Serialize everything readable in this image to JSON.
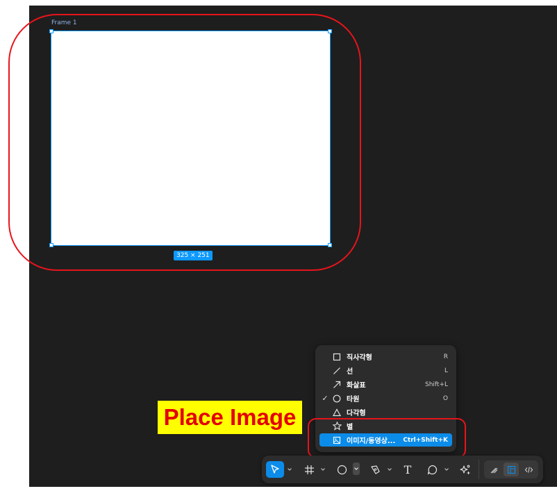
{
  "canvas": {
    "frame_label": "Frame 1",
    "size_badge": "325 × 251"
  },
  "annotation": {
    "label": "Place Image",
    "color": "#e8141b",
    "label_bg": "#ffff00"
  },
  "shape_menu": {
    "items": [
      {
        "label": "직사각형",
        "shortcut": "R",
        "icon": "rectangle-icon",
        "checked": false
      },
      {
        "label": "선",
        "shortcut": "L",
        "icon": "line-icon",
        "checked": false
      },
      {
        "label": "화살표",
        "shortcut": "Shift+L",
        "icon": "arrow-icon",
        "checked": false
      },
      {
        "label": "타원",
        "shortcut": "O",
        "icon": "ellipse-icon",
        "checked": true,
        "check_mark": "✓"
      },
      {
        "label": "다각형",
        "shortcut": "",
        "icon": "polygon-icon",
        "checked": false
      },
      {
        "label": "별",
        "shortcut": "",
        "icon": "star-icon",
        "checked": false
      },
      {
        "label": "이미지/동영상...",
        "shortcut": "Ctrl+Shift+K",
        "icon": "image-icon",
        "checked": false,
        "highlighted": true
      }
    ]
  },
  "toolbar": {
    "tools": [
      "move-icon",
      "frame-icon",
      "shape-icon",
      "pen-icon",
      "text-icon",
      "comment-icon",
      "actions-icon"
    ],
    "text_tool_glyph": "T",
    "modes": [
      "draw-mode-icon",
      "design-mode-icon",
      "dev-mode-icon"
    ],
    "accent": "#0c8ce9"
  }
}
